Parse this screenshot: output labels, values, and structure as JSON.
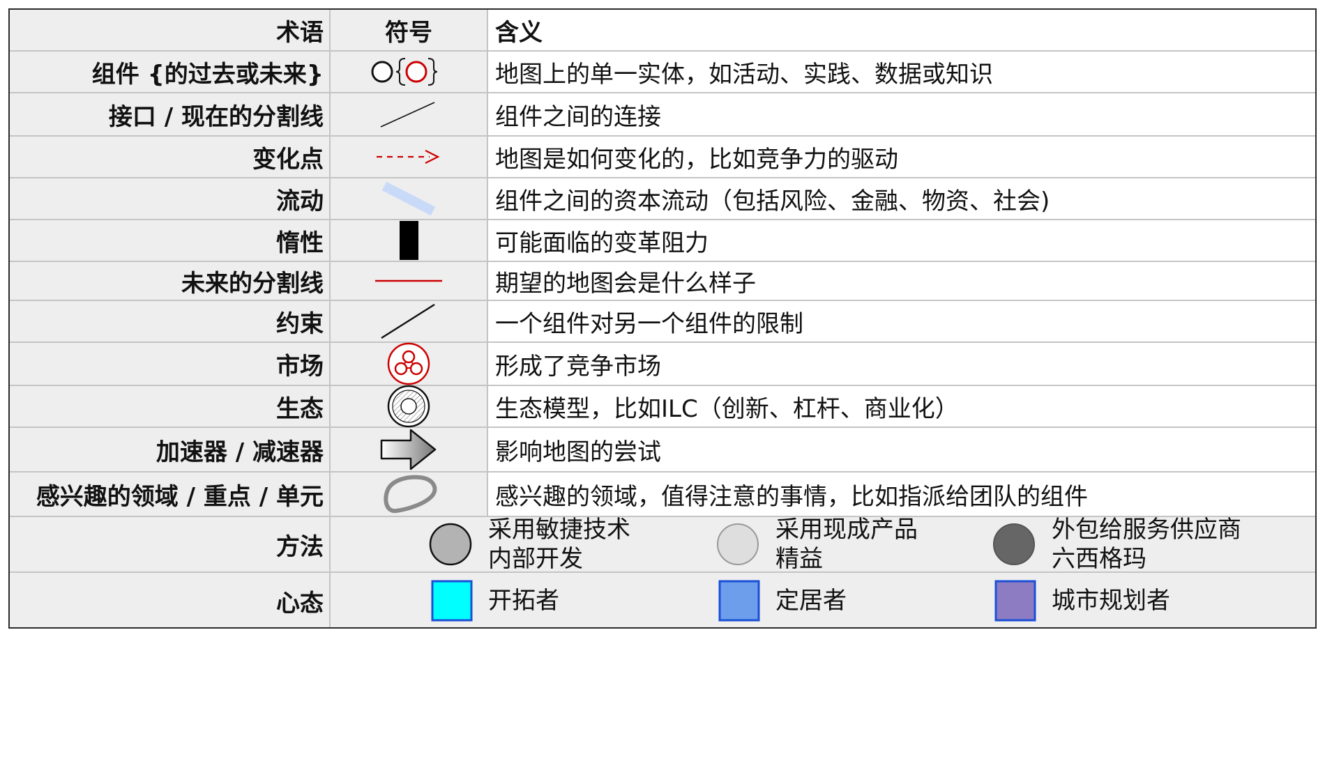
{
  "header": {
    "term": "术语",
    "symbol": "符号",
    "meaning": "含义"
  },
  "rows": [
    {
      "term": "组件 {的过去或未来}",
      "icon": "component-past-future-icon",
      "meaning": "地图上的单一实体，如活动、实践、数据或知识"
    },
    {
      "term": "接口 / 现在的分割线",
      "icon": "interface-line-icon",
      "meaning": "组件之间的连接"
    },
    {
      "term": "变化点",
      "icon": "change-arrow-icon",
      "meaning": "地图是如何变化的，比如竞争力的驱动"
    },
    {
      "term": "流动",
      "icon": "flow-band-icon",
      "meaning": "组件之间的资本流动（包括风险、金融、物资、社会)"
    },
    {
      "term": "惰性",
      "icon": "inertia-bar-icon",
      "meaning": "可能面临的变革阻力"
    },
    {
      "term": "未来的分割线",
      "icon": "future-line-icon",
      "meaning": "期望的地图会是什么样子"
    },
    {
      "term": "约束",
      "icon": "constraint-line-icon",
      "meaning": "一个组件对另一个组件的限制"
    },
    {
      "term": "市场",
      "icon": "market-icon",
      "meaning": "形成了竞争市场"
    },
    {
      "term": "生态",
      "icon": "ecosystem-icon",
      "meaning": "生态模型，比如ILC（创新、杠杆、商业化）"
    },
    {
      "term": "加速器 / 减速器",
      "icon": "accelerator-arrow-icon",
      "meaning": "影响地图的尝试"
    },
    {
      "term": "感兴趣的领域 / 重点 / 单元",
      "icon": "area-of-interest-icon",
      "meaning": "感兴趣的领域，值得注意的事情，比如指派给团队的组件"
    }
  ],
  "methods": {
    "term": "方法",
    "options": [
      {
        "line1": "采用敏捷技术",
        "line2": "内部开发",
        "color": "#b3b3b3"
      },
      {
        "line1": "采用现成产品",
        "line2": "精益",
        "color": "#dedede"
      },
      {
        "line1": "外包给服务供应商",
        "line2": "六西格玛",
        "color": "#666666"
      }
    ]
  },
  "mindset": {
    "term": "心态",
    "options": [
      {
        "label": "开拓者",
        "color": "#00ffff"
      },
      {
        "label": "定居者",
        "color": "#6d9eeb"
      },
      {
        "label": "城市规划者",
        "color": "#8e7cc3"
      }
    ]
  },
  "colors": {
    "border": "#2a2a2a",
    "grid": "#c4c4c4",
    "term_bg": "#eeeeee",
    "accent_red": "#cc0000",
    "flow_blue": "#c9daf8"
  }
}
